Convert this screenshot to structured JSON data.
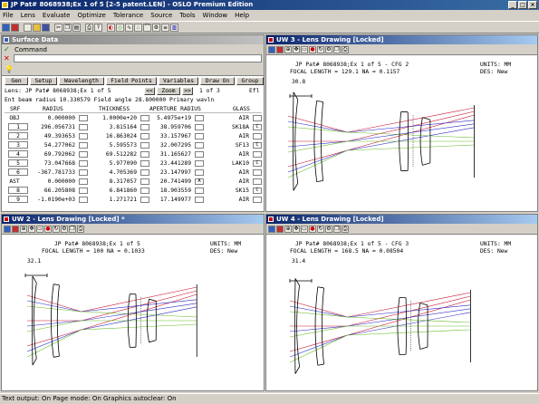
{
  "app": {
    "title": "JP Pat# 8068938;Ex 1 of 5 [2-5 patent.LEN] - OSLO Premium Edition"
  },
  "menu": [
    "File",
    "Lens",
    "Evaluate",
    "Optimize",
    "Tolerance",
    "Source",
    "Tools",
    "Window",
    "Help"
  ],
  "surface_data": {
    "title": "Surface Data",
    "command_label": "Command",
    "buttons": [
      "Gen",
      "Setup",
      "Wavelength",
      "Field Points",
      "Variables",
      "Draw On",
      "Group"
    ],
    "lens_line": "Lens: JP Pat# 8068938;Ex 1 of 5",
    "zoom_label": "Zoom",
    "page_nav": "1  of  3",
    "efl_label": "Efl",
    "info_line": "Ent beam radius   10.330579 Field angle      28.800000 Primary wavln",
    "columns": [
      "SRF",
      "RADIUS",
      "THICKNESS",
      "APERTURE RADIUS",
      "GLASS"
    ],
    "rows": [
      {
        "srf": "OBJ",
        "radius": "0.000000",
        "thickness": "1.0000e+20",
        "aperture": "5.4975e+19",
        "aflag": "",
        "glass": "AIR",
        "gflag": ""
      },
      {
        "srf": "1",
        "radius": "296.056731",
        "thickness": "3.815164",
        "aperture": "38.959706",
        "aflag": "",
        "glass": "SK18A",
        "gflag": "C"
      },
      {
        "srf": "2",
        "radius": "49.393653",
        "thickness": "16.863024",
        "aperture": "33.157967",
        "aflag": "",
        "glass": "AIR",
        "gflag": ""
      },
      {
        "srf": "3",
        "radius": "54.277062",
        "thickness": "5.595573",
        "aperture": "32.007295",
        "aflag": "",
        "glass": "SF13",
        "gflag": "C"
      },
      {
        "srf": "4",
        "radius": "69.792062",
        "thickness": "69.512282",
        "aperture": "31.165627",
        "aflag": "",
        "glass": "AIR",
        "gflag": ""
      },
      {
        "srf": "5",
        "radius": "73.047668",
        "thickness": "5.977090",
        "aperture": "23.441289",
        "aflag": "",
        "glass": "LAK10",
        "gflag": "C"
      },
      {
        "srf": "6",
        "radius": "-367.781733",
        "thickness": "4.705369",
        "aperture": "23.147997",
        "aflag": "",
        "glass": "AIR",
        "gflag": ""
      },
      {
        "srf": "AST",
        "radius": "0.000000",
        "thickness": "8.317057",
        "aperture": "20.741499",
        "aflag": "A",
        "glass": "AIR",
        "gflag": ""
      },
      {
        "srf": "8",
        "radius": "66.205808",
        "thickness": "6.841860",
        "aperture": "18.903559",
        "aflag": "",
        "glass": "SK15",
        "gflag": "C"
      },
      {
        "srf": "9",
        "radius": "-1.0190e+03",
        "thickness": "1.271721",
        "aperture": "17.149977",
        "aflag": "",
        "glass": "AIR",
        "gflag": ""
      }
    ]
  },
  "uw3": {
    "title": "UW 3 - Lens Drawing [Locked]",
    "header1": "JP Pat# 8068938;Ex 1 of 5 - CFG 2",
    "header2": "FOCAL LENGTH = 129.1   NA = 0.1157",
    "units": "UNITS: MM",
    "des": "DES: New",
    "scale": "30.8"
  },
  "uw2": {
    "title": "UW 2 - Lens Drawing [Locked] *",
    "header1": "JP Pat# 8068938;Ex 1 of 5",
    "header2": "FOCAL LENGTH = 100   NA = 0.1033",
    "units": "UNITS: MM",
    "des": "DES: New",
    "scale": "32.1"
  },
  "uw4": {
    "title": "UW 4 - Lens Drawing [Locked]",
    "header1": "JP Pat# 8068938;Ex 1 of 5 - CFG 3",
    "header2": "FOCAL LENGTH = 168.5   NA = 0.08504",
    "units": "UNITS: MM",
    "des": "DES: New",
    "scale": "31.4"
  },
  "status": "Text output: On   Page mode: On   Graphics autoclear: On",
  "colors": {
    "ray_red": "#c8102e",
    "ray_blue": "#2a2acc",
    "ray_green": "#66bb22",
    "lens_stroke": "#000000",
    "title_active": "#0a246a"
  }
}
